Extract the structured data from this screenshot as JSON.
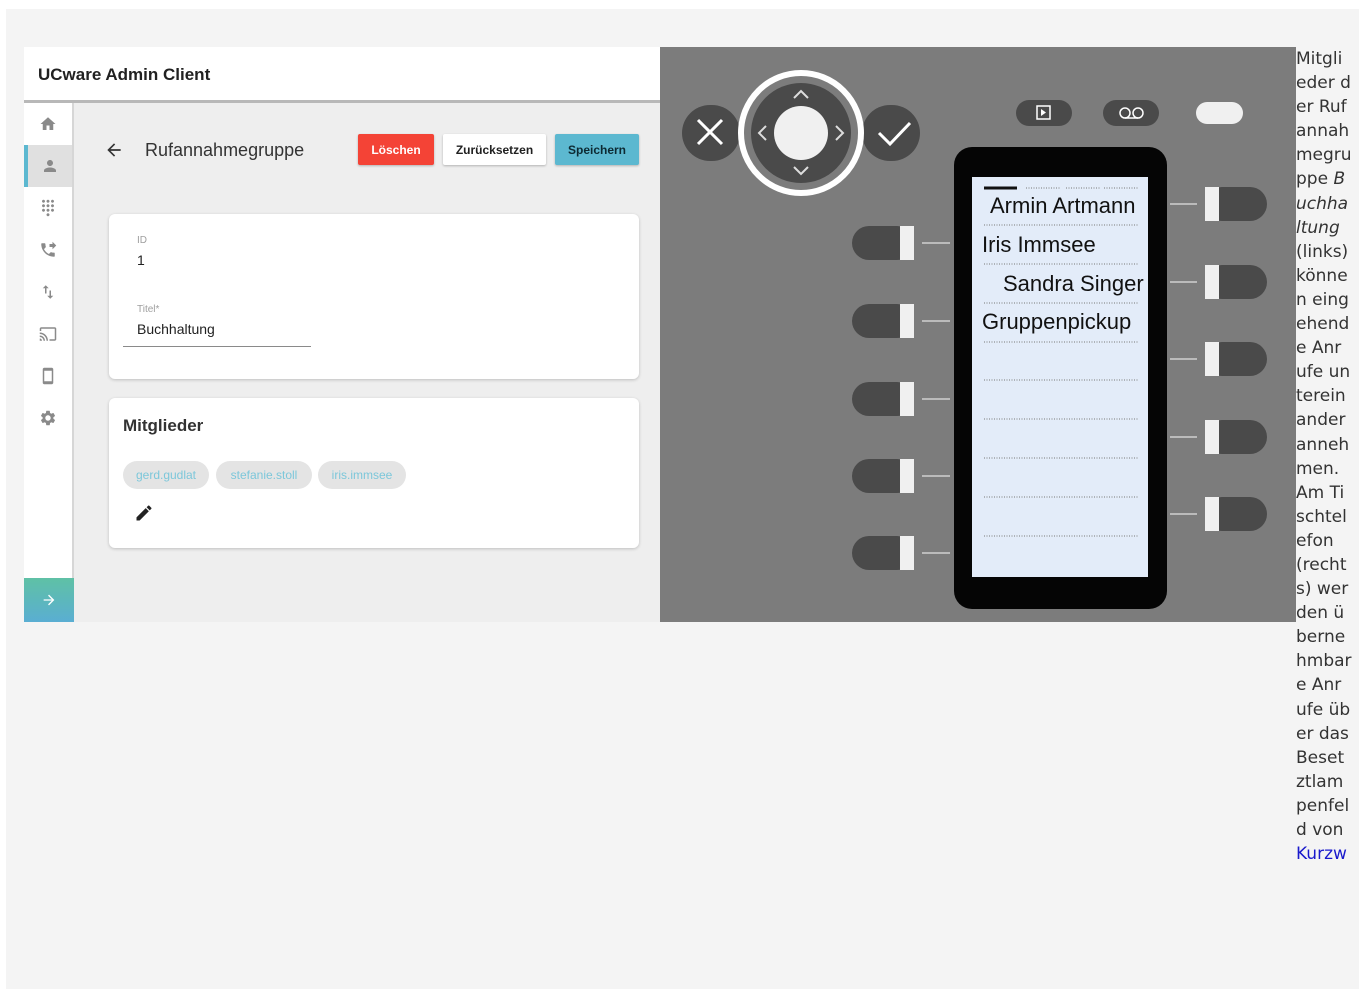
{
  "admin": {
    "app_title": "UCware Admin Client",
    "page_title": "Rufannahmegruppe",
    "buttons": {
      "delete": "Löschen",
      "reset": "Zurücksetzen",
      "save": "Speichern"
    },
    "id_card": {
      "id_label": "ID",
      "id_value": "1",
      "title_label": "Titel*",
      "title_value": "Buchhaltung"
    },
    "members": {
      "title": "Mitglieder",
      "chips": [
        "gerd.gudlat",
        "stefanie.stoll",
        "iris.immsee"
      ]
    },
    "sidebar": [
      "home-icon",
      "user-icon",
      "dialpad-icon",
      "call-forward-icon",
      "swap-vert-icon",
      "cast-icon",
      "phone-device-icon",
      "settings-icon"
    ],
    "accent": "#5cb8d0"
  },
  "phone": {
    "screen_lines": [
      "Armin Artmann",
      "Iris Immsee",
      "Sandra Singer",
      "Gruppenpickup"
    ],
    "body_color": "#7c7c7c",
    "screen_color": "#e3ecf9"
  },
  "caption": {
    "part1": "Mitglieder der Rufannahmegruppe ",
    "emph": "Buchhaltung",
    "part2": " (links) können eingehende Anrufe untereinander annehmen. Am Tischtelefon (rechts) werden übernehmbare Anrufe über das Besetztlampenfeld von ",
    "link": "Kurzw"
  }
}
